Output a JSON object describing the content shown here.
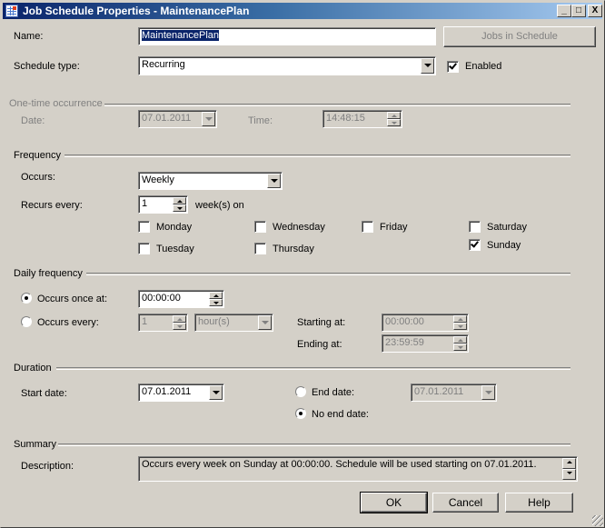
{
  "window": {
    "title": "Job Schedule Properties - MaintenancePlan",
    "controls": {
      "minimize": "_",
      "maximize": "□",
      "close": "X"
    }
  },
  "general": {
    "name_label": "Name:",
    "name_value": "MaintenancePlan",
    "jobs_button": "Jobs in Schedule",
    "schedule_type_label": "Schedule type:",
    "schedule_type_value": "Recurring",
    "enabled_label": "Enabled",
    "enabled": true
  },
  "one_time": {
    "header": "One-time occurrence",
    "date_label": "Date:",
    "date_value": "07.01.2011",
    "time_label": "Time:",
    "time_value": "14:48:15"
  },
  "frequency": {
    "header": "Frequency",
    "occurs_label": "Occurs:",
    "occurs_value": "Weekly",
    "recurs_label": "Recurs every:",
    "recurs_value": "1",
    "recurs_unit": "week(s) on",
    "days": [
      {
        "label": "Monday",
        "checked": false
      },
      {
        "label": "Tuesday",
        "checked": false
      },
      {
        "label": "Wednesday",
        "checked": false
      },
      {
        "label": "Thursday",
        "checked": false
      },
      {
        "label": "Friday",
        "checked": false
      },
      {
        "label": "Saturday",
        "checked": false
      },
      {
        "label": "Sunday",
        "checked": true
      }
    ]
  },
  "daily": {
    "header": "Daily frequency",
    "once_label": "Occurs once at:",
    "once_value": "00:00:00",
    "once_selected": true,
    "every_label": "Occurs every:",
    "every_value": "1",
    "every_unit": "hour(s)",
    "starting_label": "Starting at:",
    "starting_value": "00:00:00",
    "ending_label": "Ending at:",
    "ending_value": "23:59:59"
  },
  "duration": {
    "header": "Duration",
    "start_label": "Start date:",
    "start_value": "07.01.2011",
    "end_label": "End date:",
    "end_value": "07.01.2011",
    "no_end_label": "No end date:",
    "no_end_selected": true
  },
  "summary": {
    "header": "Summary",
    "description_label": "Description:",
    "description_value": "Occurs every week on Sunday at 00:00:00. Schedule will be used starting on 07.01.2011."
  },
  "buttons": {
    "ok": "OK",
    "cancel": "Cancel",
    "help": "Help"
  }
}
